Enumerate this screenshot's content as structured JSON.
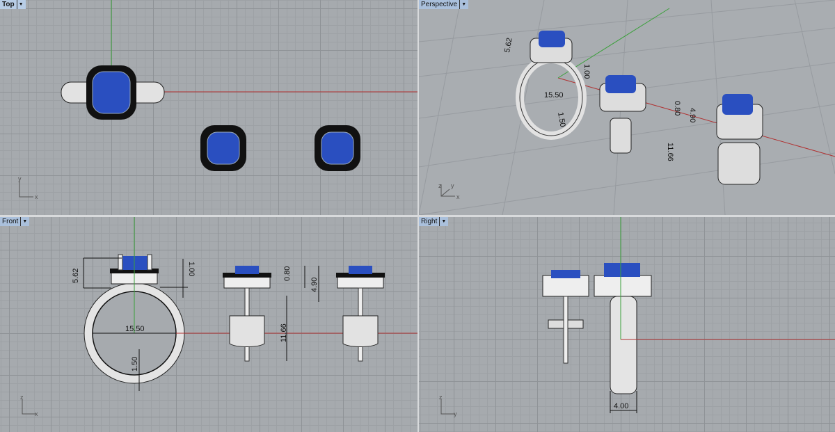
{
  "viewports": [
    {
      "name": "Top",
      "axis_labels": [
        "y",
        "x"
      ]
    },
    {
      "name": "Perspective",
      "axis_labels": [
        "z",
        "y",
        "x"
      ]
    },
    {
      "name": "Front",
      "axis_labels": [
        "z",
        "x"
      ]
    },
    {
      "name": "Right",
      "axis_labels": [
        "z",
        "y"
      ]
    }
  ],
  "dimensions": {
    "head_height": "5.62",
    "halo": "1.00",
    "ring_size": "15.50",
    "band": "1.50",
    "earring_halo": "0.80",
    "earring_head": "4.90",
    "post": "11.66",
    "shank_width": "4.00"
  },
  "colors": {
    "gem": "#2a4fc0",
    "metal": "#e4e4e4",
    "x_axis": "#b03030",
    "y_axis": "#3aa03a"
  }
}
